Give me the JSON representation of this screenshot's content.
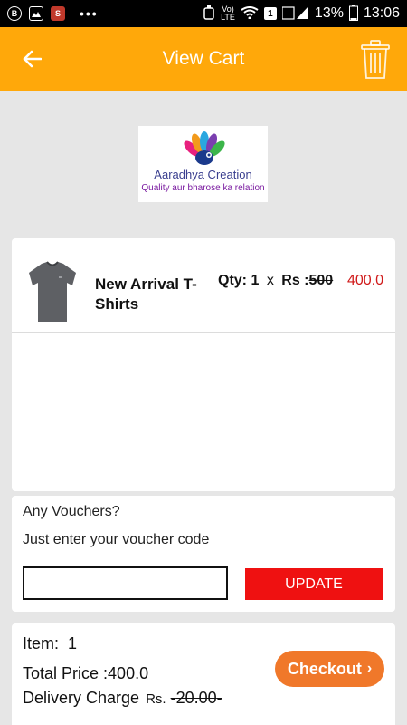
{
  "status_bar": {
    "volte_top": "Vo)",
    "volte_bottom": "LTE",
    "sim": "1",
    "battery": "13%",
    "time": "13:06"
  },
  "header": {
    "title": "View Cart",
    "back_icon": "arrow-left-icon",
    "delete_icon": "trash-icon",
    "background_color": "#ffa80a"
  },
  "logo": {
    "name": "Aaradhya Creation",
    "tagline": "Quality aur bharose ka relation"
  },
  "cart": {
    "items": [
      {
        "name": "New Arrival T-Shirts",
        "qty_label": "Qty:",
        "qty": "1",
        "times": "x",
        "rs_label": "Rs :",
        "original_price": "500",
        "price": "400.0"
      }
    ]
  },
  "voucher": {
    "question": "Any Vouchers?",
    "hint": "Just enter your voucher code",
    "input_value": "",
    "update_label": "UPDATE",
    "update_color": "#ef1111"
  },
  "summary": {
    "item_label": "Item:",
    "item_count": "1",
    "total_label": "Total Price :",
    "total_value": "400.0",
    "delivery_label": "Delivery Charge",
    "delivery_rs": "Rs.",
    "delivery_value": "20.00",
    "checkout_label": "Checkout",
    "checkout_color": "#f0782a"
  }
}
